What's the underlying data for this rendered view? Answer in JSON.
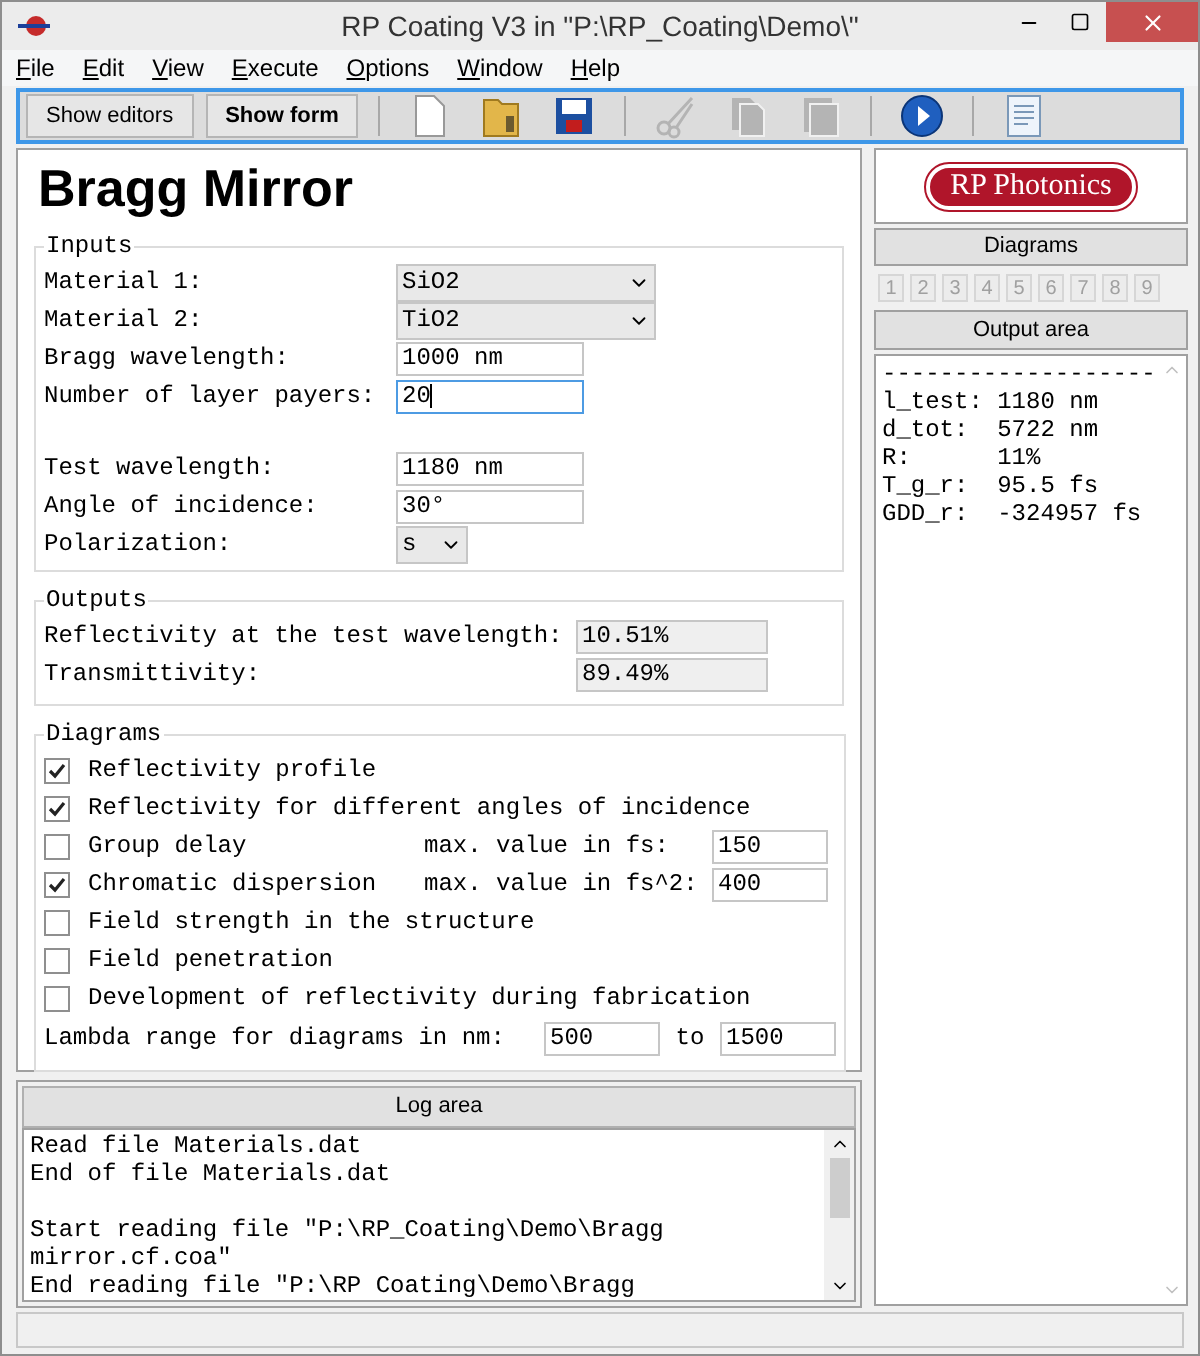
{
  "window": {
    "title": "RP Coating V3 in \"P:\\RP_Coating\\Demo\\\""
  },
  "menu": [
    "File",
    "Edit",
    "View",
    "Execute",
    "Options",
    "Window",
    "Help"
  ],
  "toolbar": {
    "buttons": [
      {
        "label": "Show editors",
        "selected": false
      },
      {
        "label": "Show form",
        "selected": true
      }
    ],
    "icons": [
      {
        "kind": "new",
        "disabled": false
      },
      {
        "kind": "open",
        "disabled": false
      },
      {
        "kind": "save",
        "disabled": false
      },
      {
        "kind": "cut",
        "disabled": true
      },
      {
        "kind": "copy",
        "disabled": true
      },
      {
        "kind": "paste",
        "disabled": true
      },
      {
        "kind": "run",
        "disabled": false
      },
      {
        "kind": "notes",
        "disabled": false
      }
    ]
  },
  "form": {
    "title": "Bragg Mirror",
    "inputs": {
      "title": "Inputs",
      "sections": [
        {
          "fields": [
            {
              "label": "Material 1:",
              "kind": "select",
              "value": "SiO2",
              "focused": false
            },
            {
              "label": "Material 2:",
              "kind": "select",
              "value": "TiO2",
              "focused": false
            },
            {
              "label": "Bragg wavelength:",
              "kind": "text",
              "value": "1000 nm",
              "focused": false
            },
            {
              "label": "Number of layer payers:",
              "kind": "text",
              "value": "20",
              "focused": true
            }
          ]
        },
        {
          "fields": [
            {
              "label": "Test wavelength:",
              "kind": "text",
              "value": "1180 nm",
              "focused": false
            },
            {
              "label": "Angle of incidence:",
              "kind": "text",
              "value": "30°",
              "focused": false
            },
            {
              "label": "Polarization:",
              "kind": "small_select",
              "value": "s",
              "focused": false
            }
          ]
        }
      ]
    },
    "outputs": {
      "title": "Outputs",
      "fields": [
        {
          "label": "Reflectivity at the test wavelength:",
          "value": "10.51%"
        },
        {
          "label": "Transmittivity:",
          "value": "89.49%"
        }
      ]
    },
    "diagrams": {
      "title": "Diagrams",
      "options": [
        {
          "label": "Reflectivity profile",
          "checked": true
        },
        {
          "label": "Reflectivity for different angles of incidence",
          "checked": true
        },
        {
          "label": "Group delay",
          "checked": false,
          "max_label": "max. value in fs:",
          "max_value": "150"
        },
        {
          "label": "Chromatic dispersion",
          "checked": true,
          "max_label": "max. value in fs^2:",
          "max_value": "400"
        },
        {
          "label": "Field strength in the structure",
          "checked": false
        },
        {
          "label": "Field penetration",
          "checked": false
        },
        {
          "label": "Development of reflectivity during fabrication",
          "checked": false
        }
      ],
      "range": {
        "label": "Lambda range for diagrams in nm:",
        "from": "500",
        "to_label": "to",
        "to": "1500"
      }
    }
  },
  "log": {
    "title": "Log area",
    "paragraphs": [
      [
        "Read file Materials.dat",
        "End of file Materials.dat"
      ],
      [
        "Start reading file \"P:\\RP_Coating\\Demo\\Bragg",
        "mirror.cf.coa\"",
        "End reading file \"P:\\RP Coating\\Demo\\Bragg"
      ]
    ]
  },
  "side": {
    "logo": "RP Photonics",
    "diagrams_button": "Diagrams",
    "diagram_tabs": [
      "1",
      "2",
      "3",
      "4",
      "5",
      "6",
      "7",
      "8",
      "9"
    ],
    "output_title": "Output area",
    "output_lines": [
      "-------------------",
      "l_test: 1180 nm",
      "d_tot:  5722 nm",
      "R:      11%",
      "T_g_r:  95.5 fs",
      "GDD_r:  -324957 fs"
    ]
  }
}
